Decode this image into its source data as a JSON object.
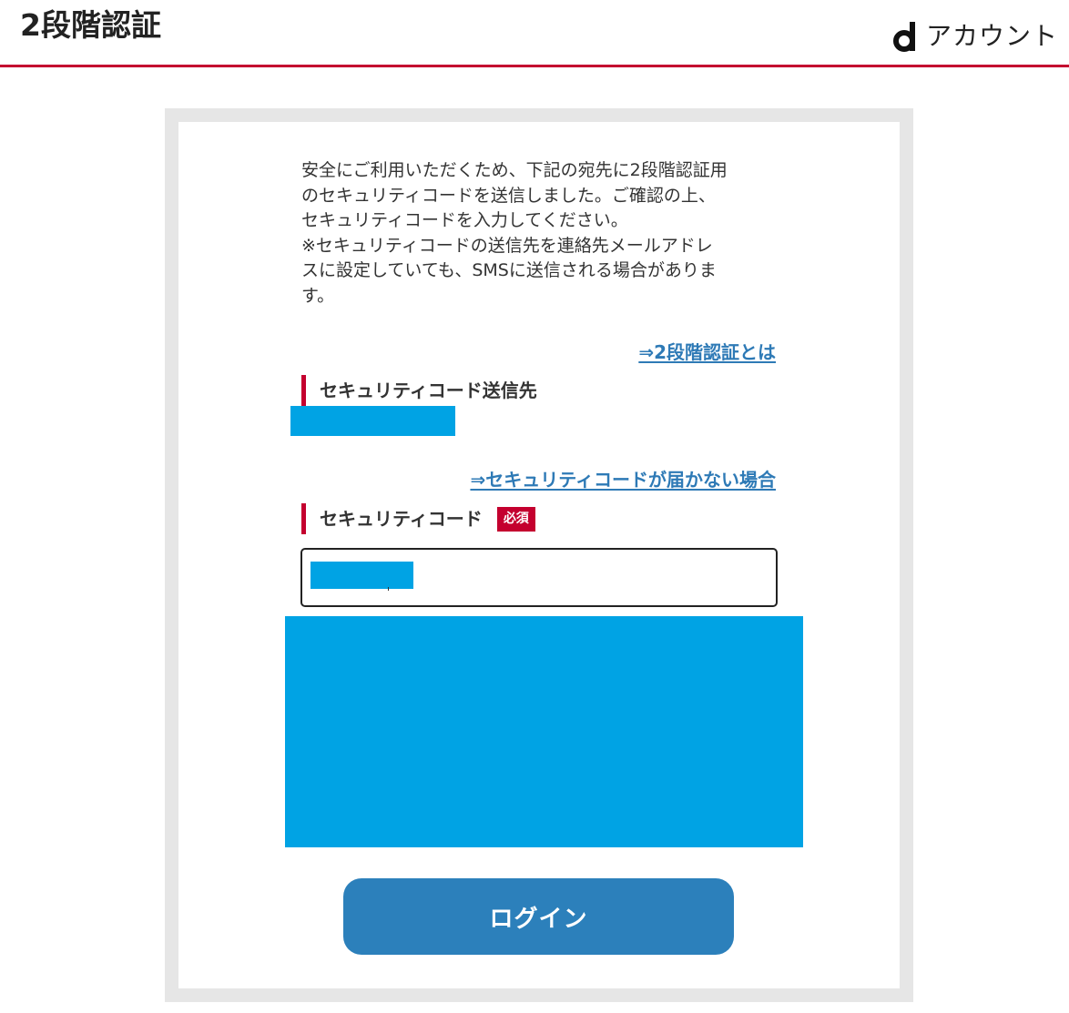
{
  "header": {
    "title": "2段階認証",
    "brand_letter": "d",
    "brand_text": "アカウント"
  },
  "notice": {
    "lines": [
      "安全にご利用いただくため、下記の宛先に2段階認証用",
      "のセキュリティコードを送信しました。ご確認の上、",
      "セキュリティコードを入力してください。",
      "※セキュリティコードの送信先を連絡先メールアドレ",
      "スに設定していても、SMSに送信される場合がありま",
      "す。"
    ]
  },
  "links": {
    "about_two_step": "⇒2段階認証とは",
    "code_not_arrived": "⇒セキュリティコードが届かない場合"
  },
  "destination": {
    "heading": "セキュリティコード送信先"
  },
  "security_code": {
    "heading": "セキュリティコード",
    "required_badge": "必須"
  },
  "login_button": {
    "label": "ログイン"
  },
  "colors": {
    "accent_red": "#c4002f",
    "link_blue": "#2e7ab6",
    "button_blue": "#2c80bb",
    "redaction_blue": "#00a3e4",
    "frame_gray": "#e6e6e6"
  }
}
